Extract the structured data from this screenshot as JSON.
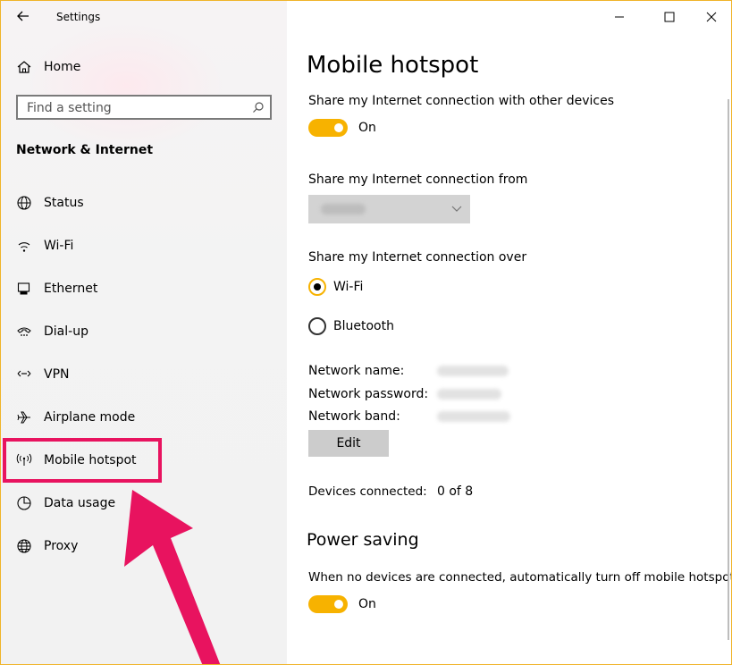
{
  "window": {
    "title": "Settings"
  },
  "sidebar": {
    "home_label": "Home",
    "search_placeholder": "Find a setting",
    "section_title": "Network & Internet",
    "items": [
      {
        "label": "Status",
        "icon": "globe-icon"
      },
      {
        "label": "Wi-Fi",
        "icon": "wifi-icon"
      },
      {
        "label": "Ethernet",
        "icon": "ethernet-icon"
      },
      {
        "label": "Dial-up",
        "icon": "dialup-icon"
      },
      {
        "label": "VPN",
        "icon": "vpn-icon"
      },
      {
        "label": "Airplane mode",
        "icon": "airplane-icon"
      },
      {
        "label": "Mobile hotspot",
        "icon": "hotspot-icon"
      },
      {
        "label": "Data usage",
        "icon": "data-usage-icon"
      },
      {
        "label": "Proxy",
        "icon": "globe-icon"
      }
    ]
  },
  "main": {
    "title": "Mobile hotspot",
    "share_label": "Share my Internet connection with other devices",
    "share_toggle": "On",
    "share_from_label": "Share my Internet connection from",
    "share_over_label": "Share my Internet connection over",
    "radio_wifi": "Wi-Fi",
    "radio_bluetooth": "Bluetooth",
    "network_name_label": "Network name:",
    "network_password_label": "Network password:",
    "network_band_label": "Network band:",
    "edit_button": "Edit",
    "devices_label": "Devices connected:",
    "devices_value": "0 of 8",
    "power_title": "Power saving",
    "power_desc": "When no devices are connected, automatically turn off mobile hotspot.",
    "power_toggle": "On"
  },
  "colors": {
    "accent": "#f7b200",
    "highlight": "#e8135f",
    "border": "#f0b429"
  }
}
